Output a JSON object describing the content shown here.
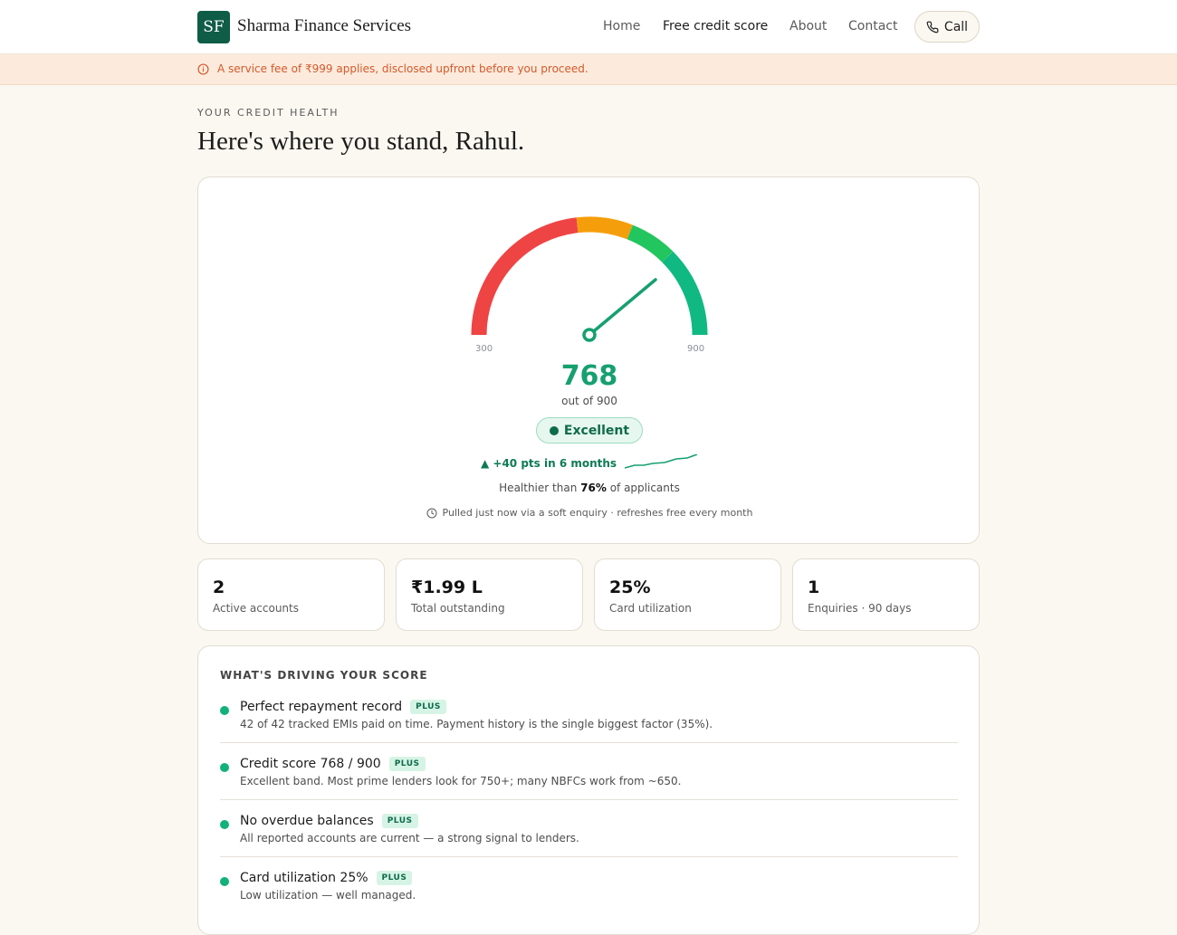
{
  "header": {
    "logo_text": "SF",
    "brand": "Sharma Finance Services",
    "nav": [
      "Home",
      "Free credit score",
      "About",
      "Contact"
    ],
    "active_nav": "Free credit score",
    "call_label": "Call"
  },
  "notice": {
    "icon": "info-circle-icon",
    "text": "A service fee of ₹999 applies, disclosed upfront before you proceed."
  },
  "hero": {
    "eyebrow": "YOUR CREDIT HEALTH",
    "greeting": "Here's where you stand, Rahul."
  },
  "score": {
    "value": "768",
    "out_of": "out of 900",
    "min_label": "300",
    "max_label": "900",
    "band": "Excellent",
    "trend": "▲ +40 pts in 6 months",
    "healthier_prefix": "Healthier than",
    "healthier_pct": "76%",
    "healthier_suffix": "of applicants",
    "pulled": "Pulled just now via a soft enquiry · refreshes free every month"
  },
  "stats": [
    {
      "value": "2",
      "label": "Active accounts"
    },
    {
      "value": "₹1.99 L",
      "label": "Total outstanding"
    },
    {
      "value": "25%",
      "label": "Card utilization"
    },
    {
      "value": "1",
      "label": "Enquiries · 90 days"
    }
  ],
  "drivers": {
    "title": "WHAT'S DRIVING YOUR SCORE",
    "items": [
      {
        "title": "Perfect repayment record",
        "tag": "PLUS",
        "desc": "42 of 42 tracked EMIs paid on time. Payment history is the single biggest factor (35%)."
      },
      {
        "title": "Credit score 768 / 900",
        "tag": "PLUS",
        "desc": "Excellent band. Most prime lenders look for 750+; many NBFCs work from ~650."
      },
      {
        "title": "No overdue balances",
        "tag": "PLUS",
        "desc": "All reported accounts are current — a strong signal to lenders."
      },
      {
        "title": "Card utilization 25%",
        "tag": "PLUS",
        "desc": "Low utilization — well managed."
      }
    ]
  },
  "colors": {
    "brand": "#0f5c47",
    "gauge_red": "#ef4444",
    "gauge_amber": "#f59e0b",
    "gauge_green": "#22c55e",
    "gauge_teal": "#10b981",
    "accent": "#16a06f",
    "notice": "#d4592a"
  }
}
